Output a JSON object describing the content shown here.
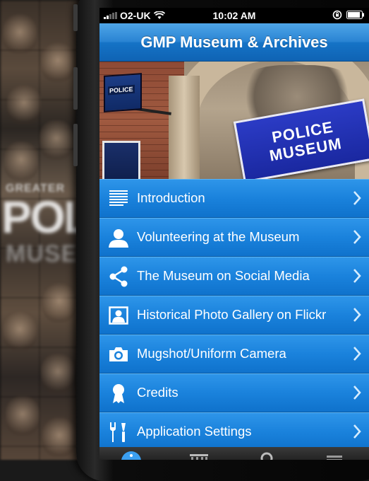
{
  "status": {
    "carrier": "O2-UK",
    "time": "10:02 AM"
  },
  "nav": {
    "title": "GMP Museum & Archives"
  },
  "hero": {
    "lamp_text": "POLICE",
    "sign_line1": "POLICE",
    "sign_line2": "MUSEUM"
  },
  "background": {
    "small_text": "GREATER",
    "big_text": "POL",
    "museum_text": "MUSEU"
  },
  "menu": [
    {
      "label": "Introduction",
      "icon": "document-lines-icon"
    },
    {
      "label": "Volunteering at the Museum",
      "icon": "person-icon"
    },
    {
      "label": "The Museum on Social Media",
      "icon": "share-icon"
    },
    {
      "label": "Historical Photo Gallery on Flickr",
      "icon": "photo-portrait-icon"
    },
    {
      "label": "Mugshot/Uniform Camera",
      "icon": "camera-icon"
    },
    {
      "label": "Credits",
      "icon": "award-ribbon-icon"
    },
    {
      "label": "Application Settings",
      "icon": "tools-icon"
    }
  ],
  "tabs": [
    "info-tab-icon",
    "museum-tab-icon",
    "search-tab-icon",
    "more-tab-icon"
  ],
  "colors": {
    "nav_top": "#4fa6e8",
    "nav_bottom": "#0f63b4",
    "row": "#1a82dc"
  }
}
